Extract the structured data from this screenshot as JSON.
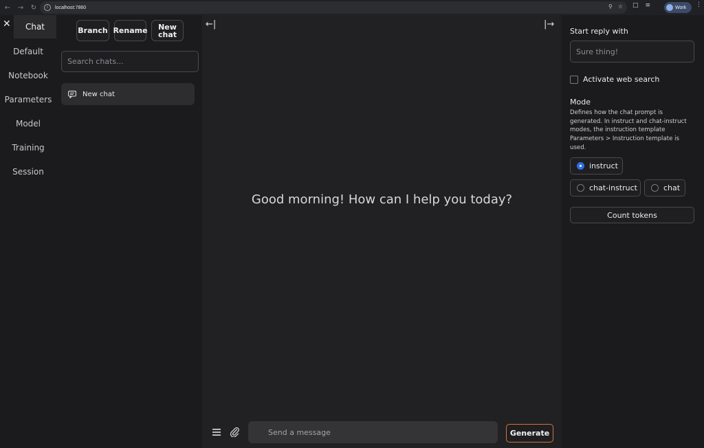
{
  "browser": {
    "url": "localhost:7860",
    "profile_name": "Work"
  },
  "tabs": [
    {
      "label": "Chat",
      "active": true
    },
    {
      "label": "Default"
    },
    {
      "label": "Notebook"
    },
    {
      "label": "Parameters"
    },
    {
      "label": "Model"
    },
    {
      "label": "Training"
    },
    {
      "label": "Session"
    }
  ],
  "chat_controls": {
    "branch_label": "Branch",
    "rename_label": "Rename",
    "new_chat_label_line1": "New",
    "new_chat_label_line2": "chat",
    "search_placeholder": "Search chats...",
    "chats": [
      {
        "label": "New chat"
      }
    ]
  },
  "main": {
    "greeting": "Good morning! How can I help you today?",
    "message_placeholder": "Send a message",
    "generate_label": "Generate"
  },
  "right_panel": {
    "start_reply_label": "Start reply with",
    "start_reply_placeholder": "Sure thing!",
    "web_search_label": "Activate web search",
    "mode_label": "Mode",
    "mode_description": "Defines how the chat prompt is generated. In instruct and chat-instruct modes, the instruction template Parameters > Instruction template is used.",
    "modes": [
      {
        "label": "instruct",
        "checked": true
      },
      {
        "label": "chat-instruct",
        "checked": false
      },
      {
        "label": "chat",
        "checked": false
      }
    ],
    "count_tokens_label": "Count tokens"
  },
  "colors": {
    "accent": "#2f6fe0",
    "generate_border": "#d8743a"
  }
}
